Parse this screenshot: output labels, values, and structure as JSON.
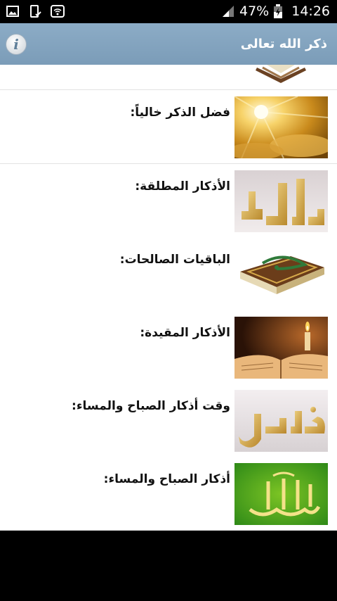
{
  "status_bar": {
    "battery": "47%",
    "time": "14:26"
  },
  "app_bar": {
    "title": "ذكر الله تعالى",
    "info_glyph": "i"
  },
  "items": [
    {
      "label": "فضل الذكر خالياً:",
      "thumb": "sunlit-clouds"
    },
    {
      "label": "الأذكار المطلقة:",
      "thumb": "golden-allah-letters"
    },
    {
      "label": "الباقيات الصالحات:",
      "thumb": "quran-with-rosary"
    },
    {
      "label": "الأذكار المقيدة:",
      "thumb": "candle-and-book"
    },
    {
      "label": "وقت أذكار الصباح والمساء:",
      "thumb": "golden-razzaq-letters"
    },
    {
      "label": "أذكار الصباح والمساء:",
      "thumb": "allah-calligraphy-green"
    }
  ]
}
